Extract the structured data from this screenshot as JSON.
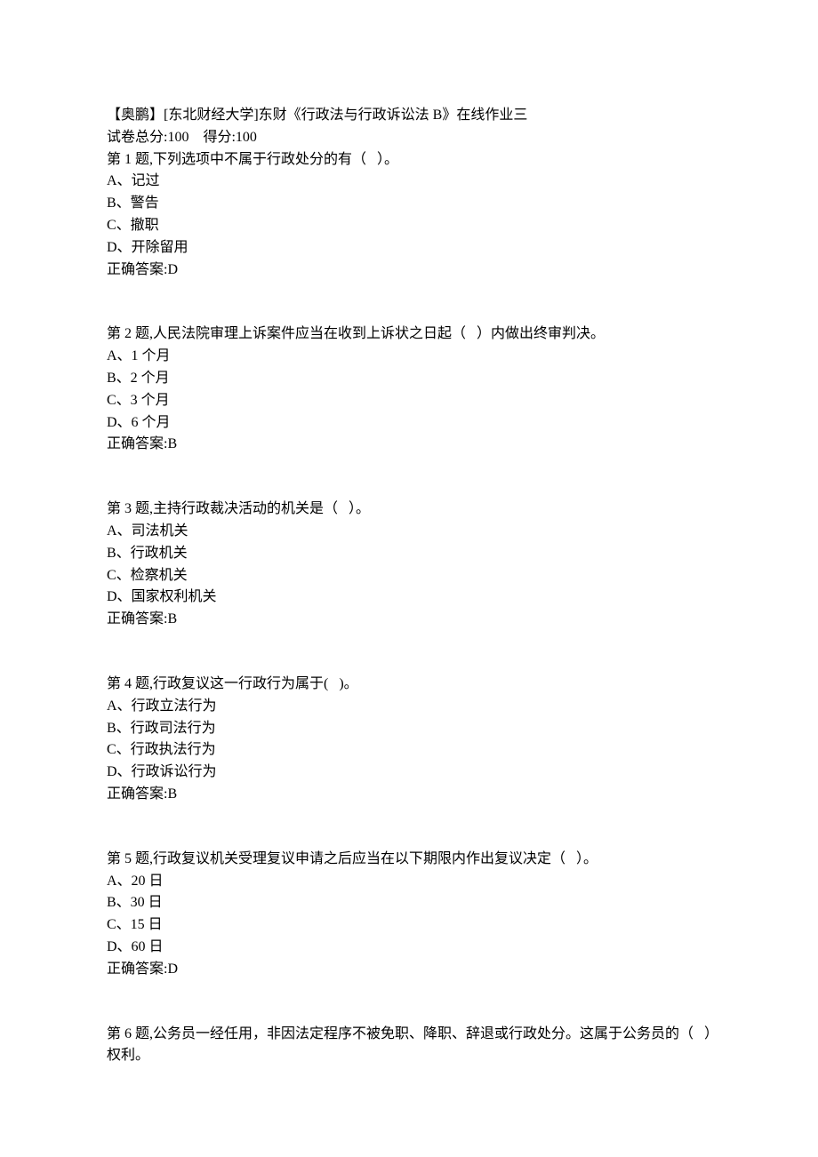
{
  "header": {
    "title": "【奥鹏】[东北财经大学]东财《行政法与行政诉讼法 B》在线作业三",
    "score_line": "试卷总分:100    得分:100"
  },
  "questions": [
    {
      "stem": "第 1 题,下列选项中不属于行政处分的有（   ）。",
      "options": [
        "A、记过",
        "B、警告",
        "C、撤职",
        "D、开除留用"
      ],
      "answer": "正确答案:D"
    },
    {
      "stem": "第 2 题,人民法院审理上诉案件应当在收到上诉状之日起（   ）内做出终审判决。",
      "options": [
        "A、1 个月",
        "B、2 个月",
        "C、3 个月",
        "D、6 个月"
      ],
      "answer": "正确答案:B"
    },
    {
      "stem": "第 3 题,主持行政裁决活动的机关是（   ）。",
      "options": [
        "A、司法机关",
        "B、行政机关",
        "C、检察机关",
        "D、国家权利机关"
      ],
      "answer": "正确答案:B"
    },
    {
      "stem": "第 4 题,行政复议这一行政行为属于(   )。",
      "options": [
        "A、行政立法行为",
        "B、行政司法行为",
        "C、行政执法行为",
        "D、行政诉讼行为"
      ],
      "answer": "正确答案:B"
    },
    {
      "stem": "第 5 题,行政复议机关受理复议申请之后应当在以下期限内作出复议决定（   ）。",
      "options": [
        "A、20 日",
        "B、30 日",
        "C、15 日",
        "D、60 日"
      ],
      "answer": "正确答案:D"
    },
    {
      "stem": "第 6 题,公务员一经任用，非因法定程序不被免职、降职、辞退或行政处分。这属于公务员的（   ）权利。",
      "options": [],
      "answer": ""
    }
  ]
}
